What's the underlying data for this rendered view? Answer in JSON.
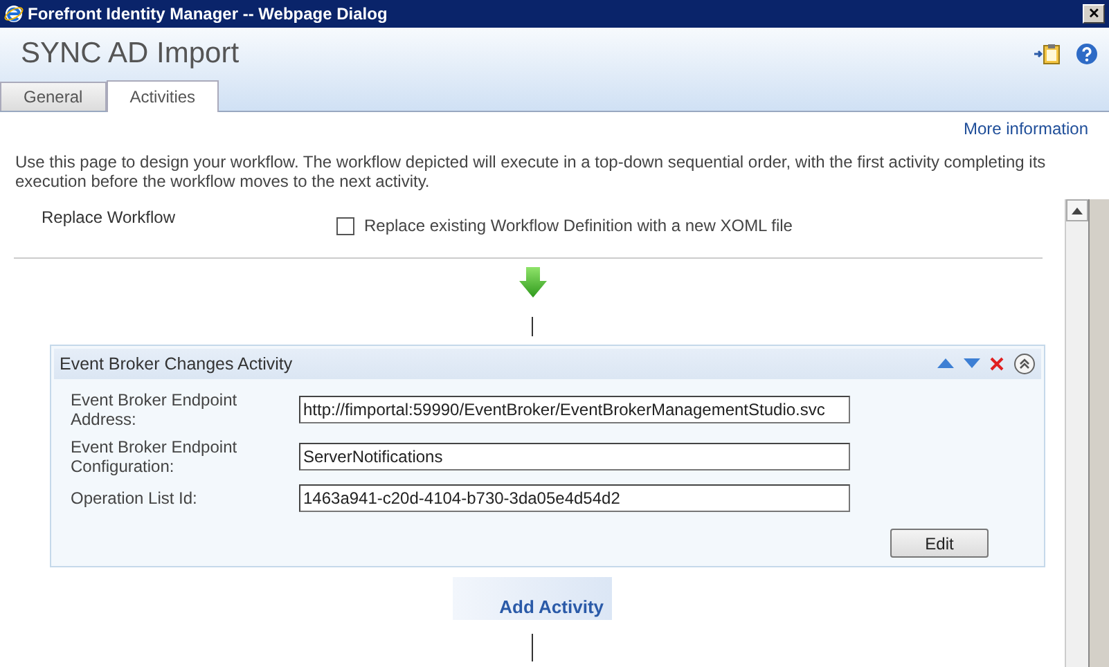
{
  "window": {
    "title": "Forefront Identity Manager -- Webpage Dialog",
    "close": "✕"
  },
  "page_title": "SYNC AD Import",
  "tabs": [
    {
      "label": "General",
      "selected": false
    },
    {
      "label": "Activities",
      "selected": true
    }
  ],
  "more_information": "More information",
  "description": "Use this page to design your workflow. The workflow depicted will execute in a top-down sequential order, with the first activity completing its execution before the workflow moves to the next activity.",
  "replace_workflow": {
    "label": "Replace Workflow",
    "checkbox_label": "Replace existing Workflow Definition with a new XOML file",
    "checked": false
  },
  "activity": {
    "title": "Event Broker Changes Activity",
    "fields": [
      {
        "label": "Event Broker Endpoint Address:",
        "value": "http://fimportal:59990/EventBroker/EventBrokerManagementStudio.svc"
      },
      {
        "label": "Event Broker Endpoint Configuration:",
        "value": "ServerNotifications"
      },
      {
        "label": "Operation List Id:",
        "value": "1463a941-c20d-4104-b730-3da05e4d54d2"
      }
    ],
    "edit_button": "Edit"
  },
  "add_activity": "Add Activity"
}
